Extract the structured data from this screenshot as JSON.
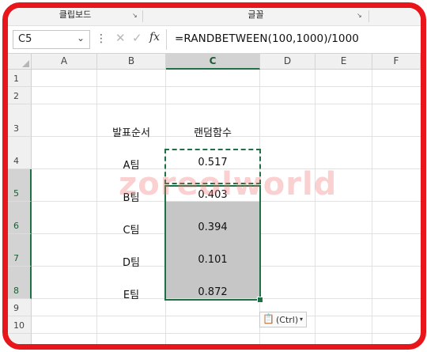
{
  "ribbon": {
    "clipboard_label": "클립보드",
    "font_label": "글꼴"
  },
  "formula_bar": {
    "name_box": "C5",
    "formula": "=RANDBETWEEN(100,1000)/1000",
    "cancel_icon": "close-icon",
    "enter_icon": "check-icon",
    "fx_label": "fx"
  },
  "sheet": {
    "columns": [
      "A",
      "B",
      "C",
      "D",
      "E",
      "F"
    ],
    "selected_column": "C",
    "rows": [
      "1",
      "2",
      "3",
      "4",
      "5",
      "6",
      "7",
      "8",
      "9",
      "10"
    ],
    "selected_rows": [
      "5",
      "6",
      "7",
      "8"
    ],
    "header_b": "발표순서",
    "header_c": "랜덤함수",
    "teams": [
      "A팀",
      "B팀",
      "C팀",
      "D팀",
      "E팀"
    ],
    "values": [
      "0.517",
      "0.403",
      "0.394",
      "0.101",
      "0.872"
    ]
  },
  "paste_options": {
    "label": "(Ctrl)",
    "icon": "clipboard-paste-icon"
  },
  "watermark": "zoreolworld",
  "colors": {
    "frame": "#e8161a",
    "selection": "#1e7145",
    "selected_fill": "#c6c6c6"
  }
}
